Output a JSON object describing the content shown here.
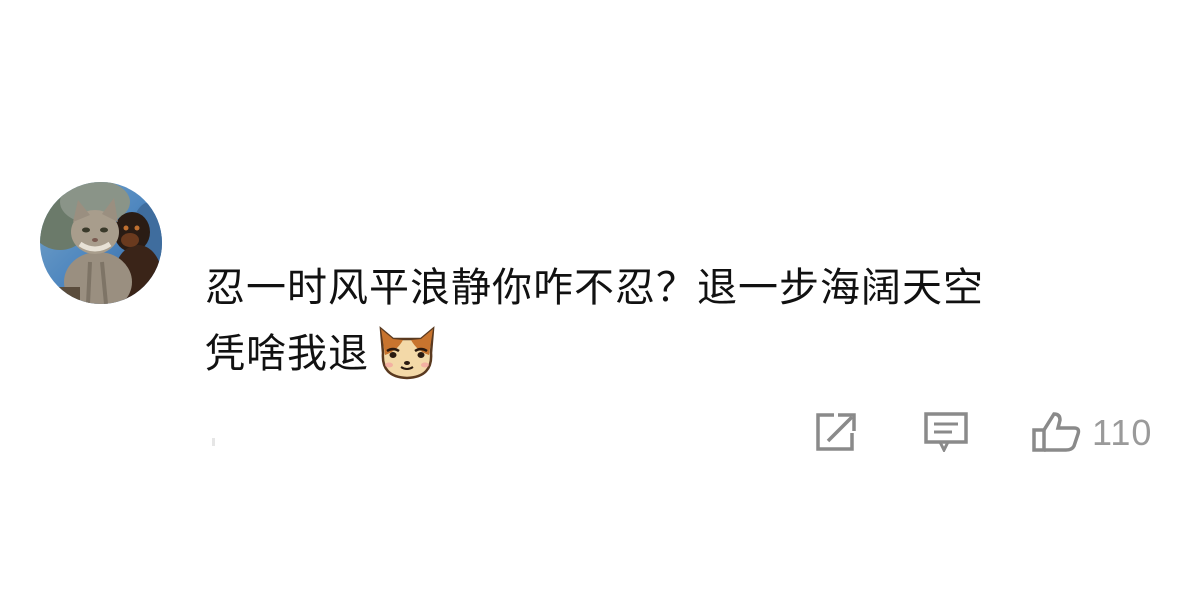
{
  "comment": {
    "avatar_alt": "cat-and-dog-avatar",
    "text_lines": [
      "忍一时风平浪静你咋不忍？退一步海阔天空",
      "凭啥我退"
    ],
    "emoji": "cat-face-emoji"
  },
  "actions": {
    "share_icon": "share-icon",
    "reply_icon": "reply-icon",
    "like_icon": "thumbs-up-icon",
    "like_count": "110"
  },
  "colors": {
    "text": "#111111",
    "icon": "#8a8a8a",
    "background": "#ffffff"
  }
}
